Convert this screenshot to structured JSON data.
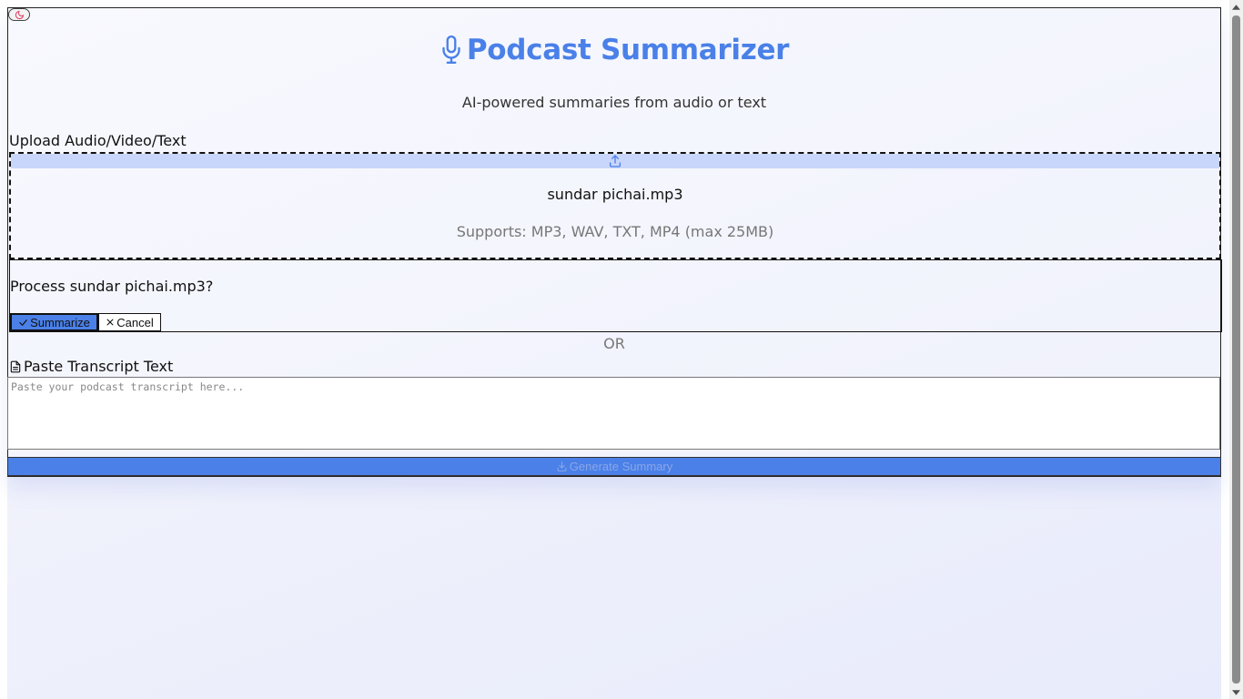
{
  "header": {
    "title": "Podcast Summarizer",
    "subtitle": "AI-powered summaries from audio or text",
    "theme_toggle_icon": "moon-icon",
    "title_icon": "microphone-icon"
  },
  "upload": {
    "label": "Upload Audio/Video/Text",
    "icon": "upload-icon",
    "file_name": "sundar pichai.mp3",
    "supports": "Supports: MP3, WAV, TXT, MP4 (max 25MB)"
  },
  "confirm": {
    "question": "Process sundar pichai.mp3?",
    "summarize_label": "Summarize",
    "cancel_label": "Cancel"
  },
  "divider": {
    "or_text": "OR"
  },
  "transcript": {
    "label": "Paste Transcript Text",
    "placeholder": "Paste your podcast transcript here...",
    "value": ""
  },
  "actions": {
    "generate_label": "Generate Summary"
  },
  "colors": {
    "accent": "#4a80e8",
    "upload_strip": "#c8d6fb",
    "muted_text": "#777777",
    "moon_icon": "#e0456b"
  }
}
